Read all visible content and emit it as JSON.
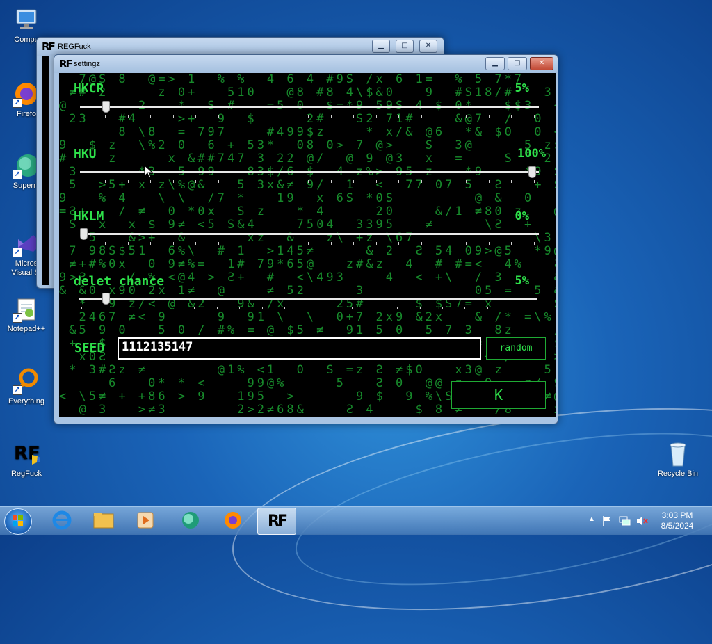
{
  "desktop": {
    "icons": [
      {
        "label": "Compu",
        "icon": "computer-icon"
      },
      {
        "label": "Firefo",
        "icon": "firefox-icon"
      },
      {
        "label": "Superm",
        "icon": "app-icon"
      },
      {
        "label": "Micros",
        "label2": "Visual St",
        "icon": "visual-studio-icon"
      },
      {
        "label": "Notepad++",
        "icon": "notepad-icon"
      },
      {
        "label": "Everything",
        "icon": "search-icon"
      },
      {
        "label": "RegFuck",
        "icon": "regfuck-icon"
      },
      {
        "label": "Recycle Bin",
        "icon": "recycle-bin-icon"
      }
    ]
  },
  "back_window": {
    "title": "REGFuck",
    "app_glyph": "RF"
  },
  "settings_window": {
    "title": "settingz",
    "app_glyph": "RF",
    "controls": [
      "0",
      "1",
      "r"
    ],
    "sliders": [
      {
        "label": "HKCR",
        "value_text": "5%",
        "value": 5
      },
      {
        "label": "HKU",
        "value_text": "100%",
        "value": 100
      },
      {
        "label": "HKLM",
        "value_text": "0%",
        "value": 0
      },
      {
        "label": "delet chance",
        "value_text": "5%",
        "value": 5
      }
    ],
    "seed": {
      "label": "SEED",
      "value": "1112135147"
    },
    "random_button": "random",
    "ok_button": "K"
  },
  "taskbar": {
    "time": "3:03 PM",
    "date": "8/5/2024"
  },
  "colors": {
    "matrix_green": "#2ee04a",
    "window_frame": "#a9c4e3",
    "desktop_blue": "#1a64b8"
  }
}
